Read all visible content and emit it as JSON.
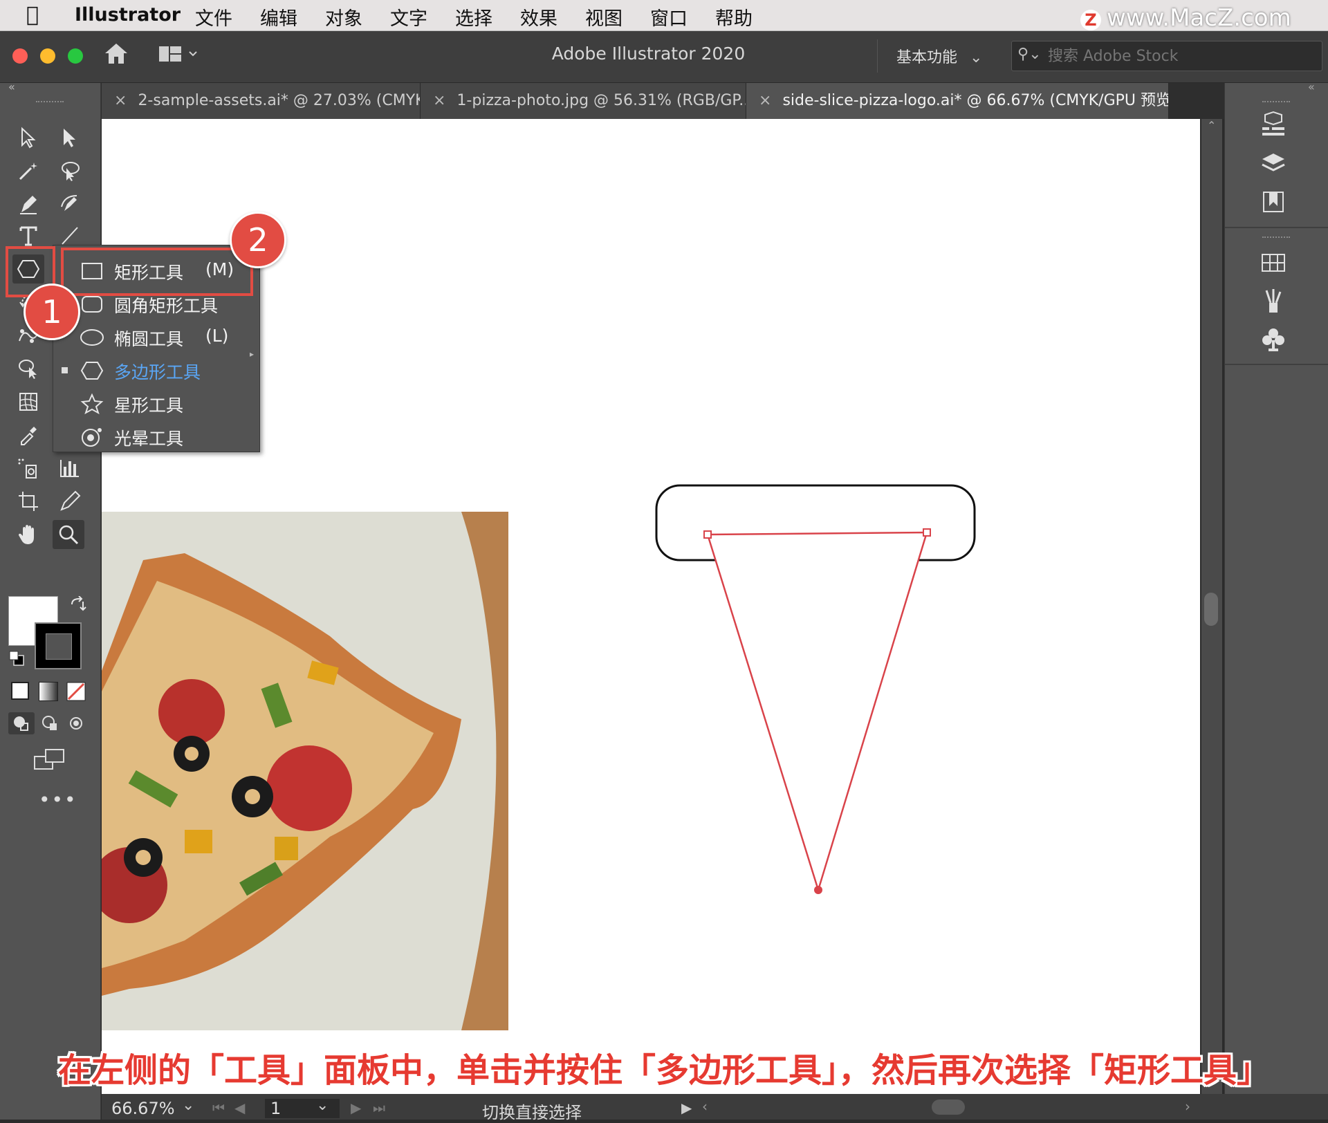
{
  "menubar": {
    "app_name": "Illustrator",
    "items": [
      "文件",
      "编辑",
      "对象",
      "文字",
      "选择",
      "效果",
      "视图",
      "窗口",
      "帮助"
    ],
    "watermark": "www.MacZ.com",
    "watermark_logo": "Z"
  },
  "appbar": {
    "title": "Adobe Illustrator 2020",
    "workspace": "基本功能",
    "search_placeholder": "搜索 Adobe Stock"
  },
  "tabs": [
    {
      "label": "2-sample-assets.ai* @ 27.03% (CMYK..."
    },
    {
      "label": "1-pizza-photo.jpg @ 56.31% (RGB/GP..."
    },
    {
      "label": "side-slice-pizza-logo.ai* @ 66.67% (CMYK/GPU 预览)",
      "active": true
    }
  ],
  "flyout": {
    "items": [
      {
        "label": "矩形工具",
        "shortcut": "(M)",
        "icon": "rectangle-icon"
      },
      {
        "label": "圆角矩形工具",
        "shortcut": "",
        "icon": "rounded-rectangle-icon"
      },
      {
        "label": "椭圆工具",
        "shortcut": "(L)",
        "icon": "ellipse-icon"
      },
      {
        "label": "多边形工具",
        "shortcut": "",
        "icon": "polygon-icon",
        "current": true
      },
      {
        "label": "星形工具",
        "shortcut": "",
        "icon": "star-icon"
      },
      {
        "label": "光晕工具",
        "shortcut": "",
        "icon": "flare-icon"
      }
    ]
  },
  "annotations": {
    "badge1": "1",
    "badge2": "2",
    "caption": "在左侧的「工具」面板中，单击并按住「多边形工具」，然后再次选择「矩形工具」"
  },
  "statusbar": {
    "zoom": "66.67%",
    "artboard": "1",
    "tool_text": "切换直接选择"
  },
  "colors": {
    "accent_red": "#e24c43",
    "selection_path": "#d9434a",
    "current_tool_blue": "#5aa6f5"
  }
}
